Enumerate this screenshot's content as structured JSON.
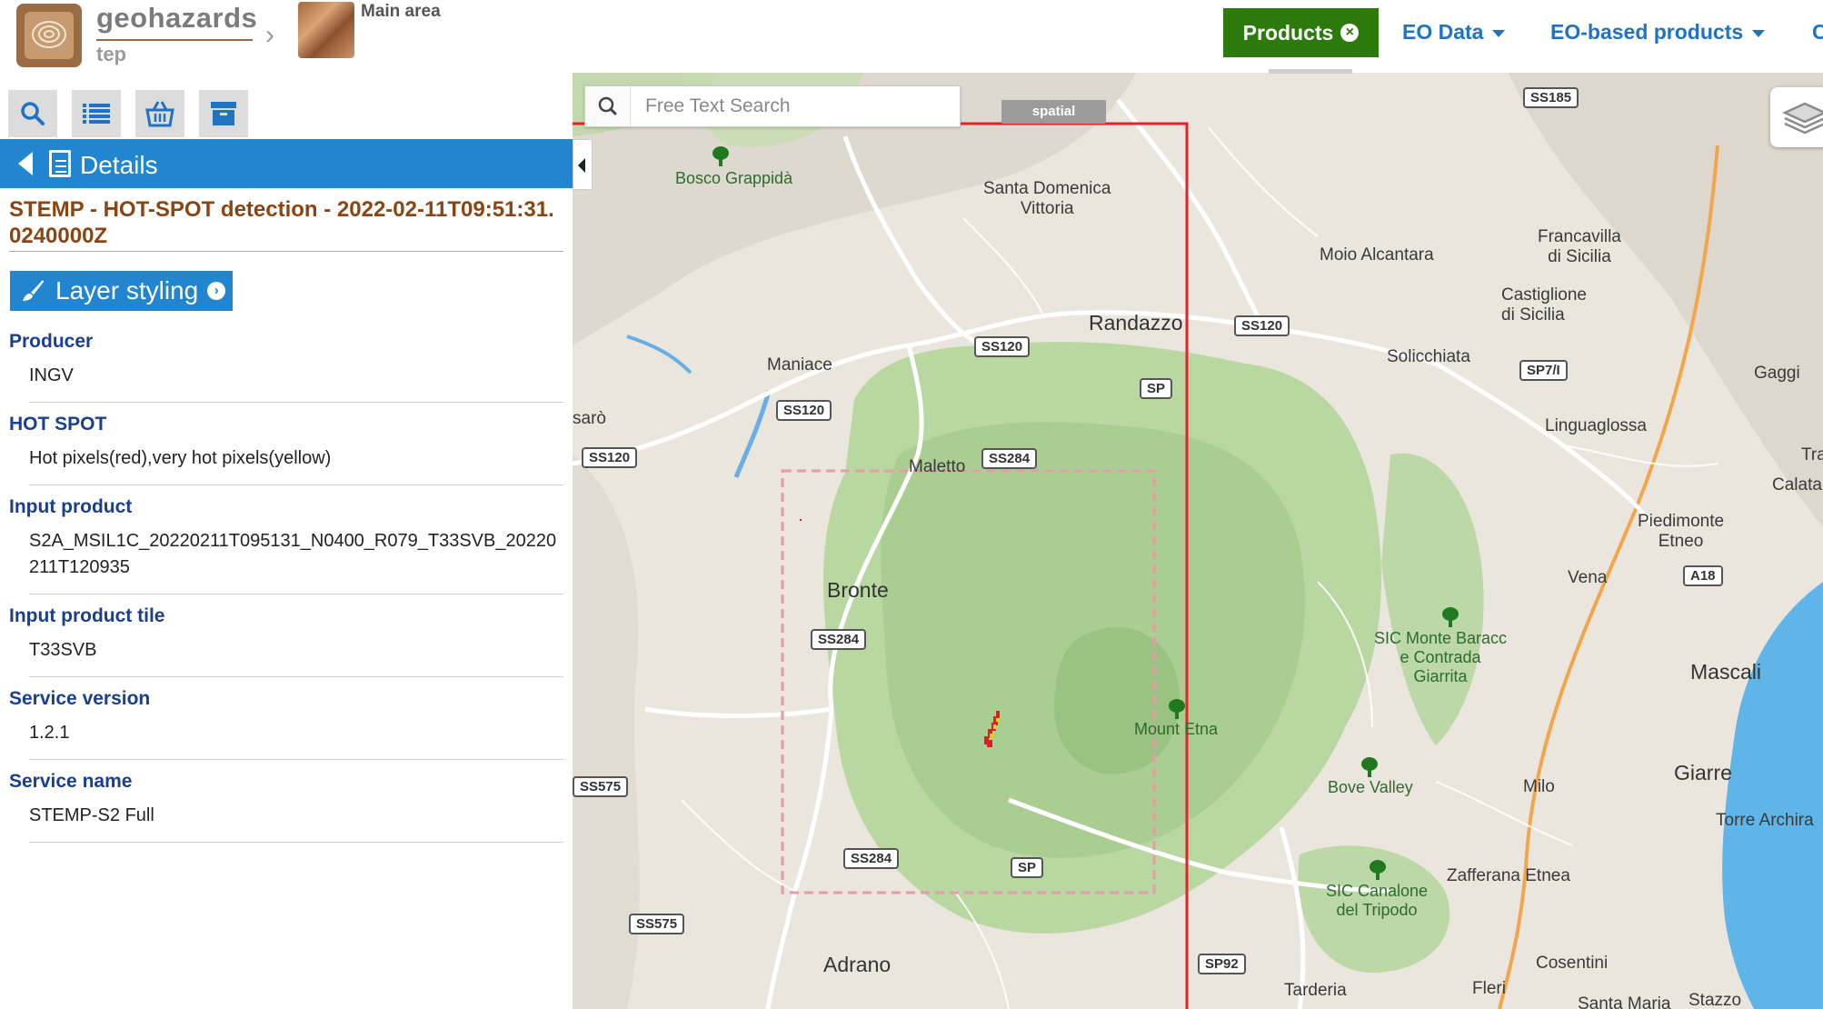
{
  "header": {
    "brand_name": "geohazards",
    "brand_sub": "tep",
    "area_label": "Main area",
    "nav": {
      "products": "Products",
      "eo_data": "EO Data",
      "eo_products": "EO-based products",
      "overflow": "C"
    }
  },
  "panel": {
    "toolbar": [
      "search-icon",
      "list-icon",
      "basket-icon",
      "archive-icon"
    ],
    "details_title": "Details",
    "product_title": "STEMP - HOT-SPOT detection - 2022-02-11T09:51:31.0240000Z",
    "styling_label": "Layer styling",
    "fields": [
      {
        "label": "Producer",
        "value": "INGV"
      },
      {
        "label": "HOT SPOT",
        "value": "Hot pixels(red),very hot pixels(yellow)"
      },
      {
        "label": "Input product",
        "value": "S2A_MSIL1C_20220211T095131_N0400_R079_T33SVB_20220211T120935"
      },
      {
        "label": "Input product tile",
        "value": "T33SVB"
      },
      {
        "label": "Service version",
        "value": "1.2.1"
      },
      {
        "label": "Service name",
        "value": "STEMP-S2 Full"
      }
    ]
  },
  "map": {
    "search_placeholder": "Free Text Search",
    "spatial_tag": "spatial",
    "places": {
      "bosco": "Bosco Grappidà",
      "santa_domenica": "Santa Domenica\nVittoria",
      "moio": "Moio Alcantara",
      "francavilla": "Francavilla\ndi Sicilia",
      "castiglione": "Castiglione\ndi Sicilia",
      "randazzo": "Randazzo",
      "solicchiata": "Solicchiata",
      "maniace": "Maniace",
      "gaggi": "Gaggi",
      "linguaglossa": "Linguaglossa",
      "saro": "sarò",
      "maletto": "Maletto",
      "tra": "Tra",
      "calatabiano": "Calatabia",
      "piedimonte": "Piedimonte\nEtneo",
      "bronte": "Bronte",
      "vena": "Vena",
      "sic_baracca": "SIC Monte Baracc\ne Contrada\nGiarrita",
      "mascali": "Mascali",
      "mount_etna": "Mount Etna",
      "bove": "Bove Valley",
      "giarre": "Giarre",
      "milo": "Milo",
      "torre": "Torre Archira",
      "zafferana": "Zafferana Etnea",
      "sic_canalone": "SIC Canalone\ndel Tripodo",
      "cosentini": "Cosentini",
      "adrano": "Adrano",
      "tarderia": "Tarderia",
      "fleri": "Fleri",
      "santa_maria": "Santa Maria",
      "stazzo": "Stazzo"
    },
    "roads": {
      "ss185": "SS185",
      "ss120a": "SS120",
      "ss120b": "SS120",
      "ss120c": "SS120",
      "ss120d": "SS120",
      "sp_a": "SP",
      "sp71": "SP7/I",
      "ss284a": "SS284",
      "ss284b": "SS284",
      "ss284c": "SS284",
      "a18": "A18",
      "ss575a": "SS575",
      "ss575b": "SS575",
      "sp_b": "SP",
      "sp92": "SP92"
    },
    "colors": {
      "aoi_border": "#e8222a",
      "tile_border": "#e79aaa",
      "hotspot_red": "#e02020",
      "hotspot_yellow": "#f2d21a",
      "park_green": "#b8d7a0",
      "sea": "#5fb4e8"
    }
  }
}
